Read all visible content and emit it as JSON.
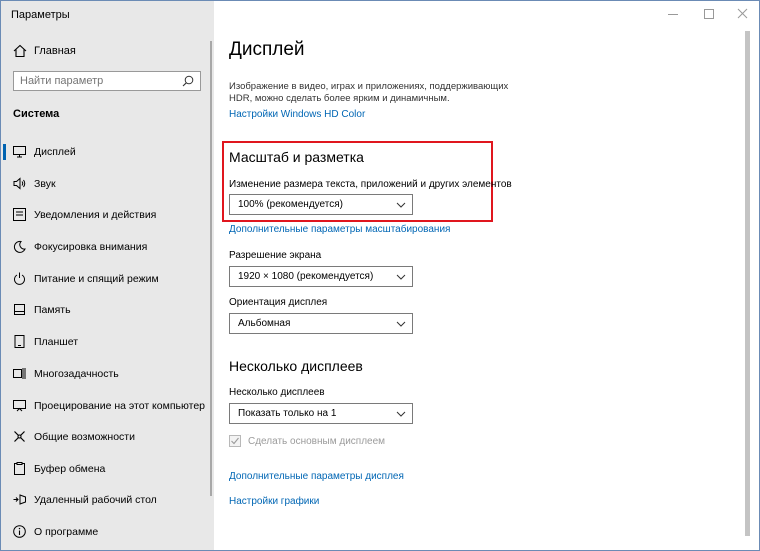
{
  "window": {
    "title": "Параметры"
  },
  "sidebar": {
    "home_label": "Главная",
    "search_placeholder": "Найти параметр",
    "section_title": "Система",
    "items": [
      {
        "label": "Дисплей",
        "icon": "monitor-icon",
        "active": true
      },
      {
        "label": "Звук",
        "icon": "speaker-icon"
      },
      {
        "label": "Уведомления и действия",
        "icon": "notification-icon"
      },
      {
        "label": "Фокусировка внимания",
        "icon": "moon-icon"
      },
      {
        "label": "Питание и спящий режим",
        "icon": "power-icon"
      },
      {
        "label": "Память",
        "icon": "storage-icon"
      },
      {
        "label": "Планшет",
        "icon": "tablet-icon"
      },
      {
        "label": "Многозадачность",
        "icon": "multitask-icon"
      },
      {
        "label": "Проецирование на этот компьютер",
        "icon": "projector-icon"
      },
      {
        "label": "Общие возможности",
        "icon": "shared-icon"
      },
      {
        "label": "Буфер обмена",
        "icon": "clipboard-icon"
      },
      {
        "label": "Удаленный рабочий стол",
        "icon": "remote-desktop-icon"
      },
      {
        "label": "О программе",
        "icon": "info-icon"
      }
    ]
  },
  "main": {
    "title": "Дисплей",
    "description": "Изображение в видео, играх и приложениях, поддерживающих HDR, можно сделать более ярким и динамичным.",
    "hd_color_link": "Настройки Windows HD Color",
    "scale_section": {
      "title": "Масштаб и разметка",
      "scale_label": "Изменение размера текста, приложений и других элементов",
      "scale_value": "100% (рекомендуется)",
      "advanced_scaling_link": "Дополнительные параметры масштабирования",
      "resolution_label": "Разрешение экрана",
      "resolution_value": "1920 × 1080 (рекомендуется)",
      "orientation_label": "Ориентация дисплея",
      "orientation_value": "Альбомная"
    },
    "multi_section": {
      "title": "Несколько дисплеев",
      "label": "Несколько дисплеев",
      "value": "Показать только на 1",
      "checkbox_label": "Сделать основным дисплеем",
      "checkbox_checked": true,
      "advanced_display_link": "Дополнительные параметры дисплея",
      "graphics_link": "Настройки графики"
    }
  },
  "colors": {
    "accent": "#0063b1",
    "link": "#0066b4",
    "highlight": "#e0161e"
  }
}
